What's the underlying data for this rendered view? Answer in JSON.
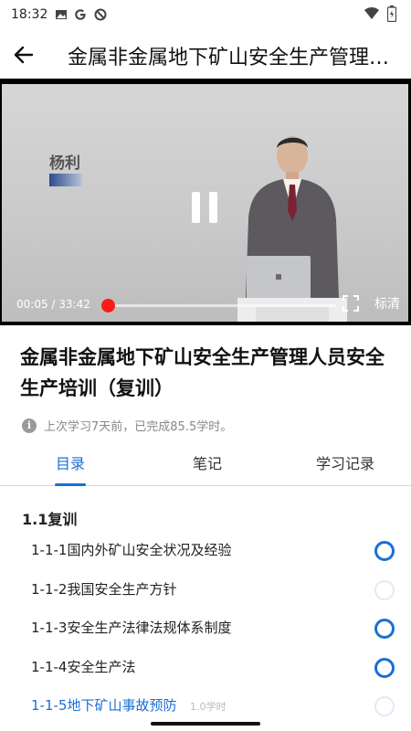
{
  "status_bar": {
    "time": "18:32",
    "left_icons": [
      "image-icon",
      "google-icon",
      "data-saver-icon"
    ],
    "right_icons": [
      "wifi-icon",
      "battery-icon"
    ]
  },
  "app_bar": {
    "title": "金属非金属地下矿山安全生产管理人员安全生产培训（复训）",
    "back_icon": "arrow-left-icon"
  },
  "video": {
    "lecturer_name": "杨利",
    "time_display": "00:05 / 33:42",
    "progress": 0.0025,
    "quality_label": "标清",
    "state": "playing",
    "accent_color": "#ff1a1a"
  },
  "course": {
    "title": "金属非金属地下矿山安全生产管理人员安全生产培训（复训）",
    "study_info": "上次学习7天前，已完成85.5学时。"
  },
  "tabs": [
    {
      "label": "目录",
      "active": true
    },
    {
      "label": "笔记",
      "active": false
    },
    {
      "label": "学习记录",
      "active": false
    }
  ],
  "catalog": {
    "section_title": "1.1复训",
    "lessons": [
      {
        "label": "1-1-1国内外矿山安全状况及经验",
        "status": "done"
      },
      {
        "label": "1-1-2我国安全生产方针",
        "status": "pending"
      },
      {
        "label": "1-1-3安全生产法律法规体系制度",
        "status": "done"
      },
      {
        "label": "1-1-4安全生产法",
        "status": "done"
      },
      {
        "label": "1-1-5地下矿山事故预防",
        "hours": "1.0学时",
        "status": "pending",
        "playing": true
      }
    ]
  },
  "colors": {
    "accent": "#1a6fd6",
    "progress_knob": "#ff1a1a"
  }
}
